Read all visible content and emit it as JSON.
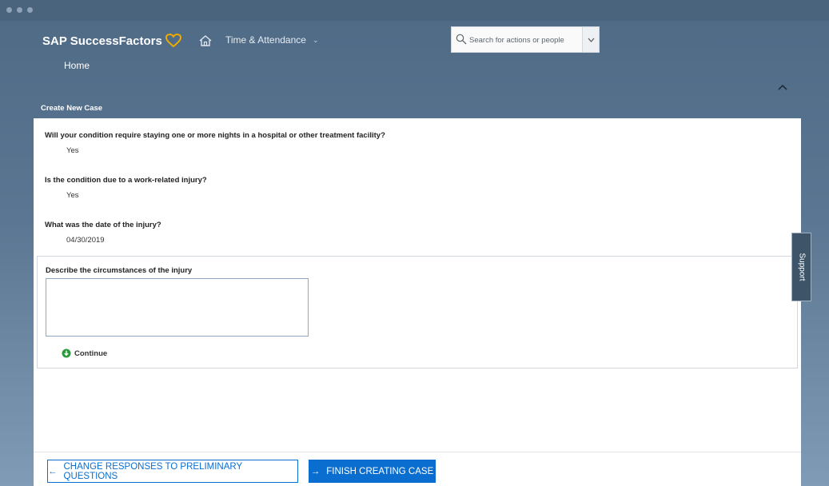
{
  "header": {
    "logo_text": "SAP SuccessFactors",
    "module_label": "Time & Attendance",
    "home_label": "Home",
    "search_placeholder": "Search for actions or people"
  },
  "page": {
    "section_title": "Create New Case"
  },
  "questions": [
    {
      "question": "Will your condition require staying one or more nights in a hospital or other treatment facility?",
      "answer": "Yes"
    },
    {
      "question": "Is the condition due to a work-related injury?",
      "answer": "Yes"
    },
    {
      "question": "What was the date of the injury?",
      "answer": "04/30/2019"
    }
  ],
  "description": {
    "label": "Describe the circumstances of the injury",
    "value": "",
    "continue_label": "Continue"
  },
  "footer": {
    "change_button": "CHANGE RESPONSES TO PRELIMINARY QUESTIONS",
    "finish_button": "FINISH CREATING CASE"
  },
  "support_tab": "Support",
  "colors": {
    "accent": "#0a6ed1",
    "logo_heart": "#f0ab00",
    "continue_green": "#2b9b3a"
  }
}
